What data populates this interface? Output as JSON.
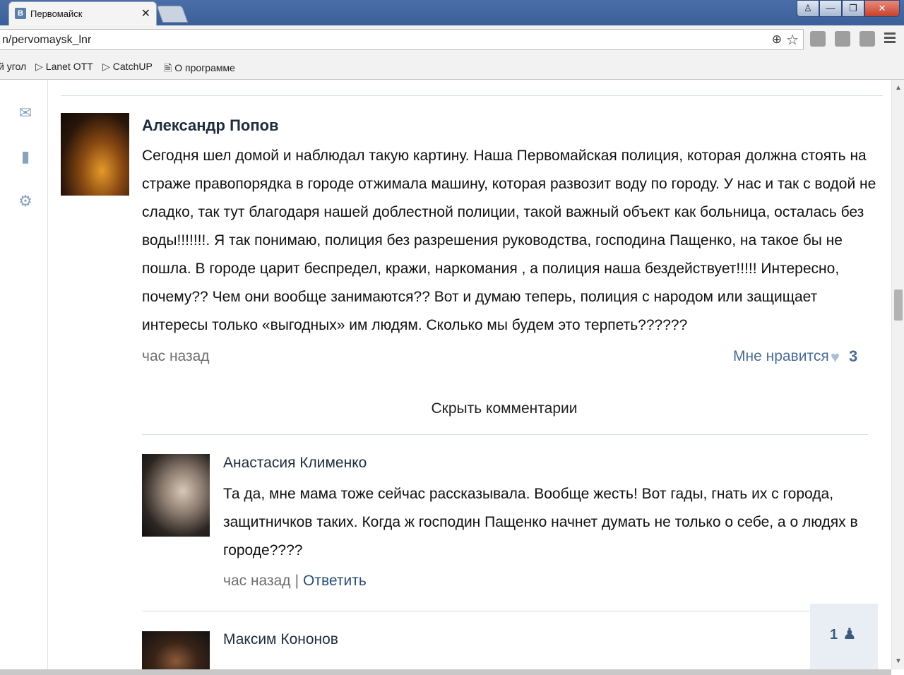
{
  "browser": {
    "tab_title": "Первомайск",
    "favicon_letter": "В",
    "tab_close": "✕",
    "url": "n/pervomaysk_lnr",
    "bookmarks": [
      {
        "label": "й угол"
      },
      {
        "label": "Lanet OTT"
      },
      {
        "label": "CatchUP"
      },
      {
        "label": "О программе"
      }
    ]
  },
  "post": {
    "author": "Александр Попов",
    "text": "Сегодня шел домой и наблюдал такую картину. Наша Первомайская полиция, которая должна стоять на страже правопорядка в городе отжимала машину, которая развозит воду по городу. У нас и так с водой не сладко, так тут благодаря нашей доблестной полиции, такой важный объект как больница, осталась без воды!!!!!!!. Я так понимаю, полиция без разрешения руководства, господина Пащенко, на такое бы не пошла. В городе царит беспредел, кражи, наркомания , а полиция наша бездействует!!!!! Интересно, почему?? Чем они вообще занимаются?? Вот и думаю теперь, полиция с народом или защищает интересы только «выгодных» им людям. Сколько мы будем это терпеть??????",
    "time": "час назад",
    "like_label": "Мне нравится",
    "like_count": "3",
    "hide_comments": "Скрыть комментарии"
  },
  "comments": [
    {
      "author": "Анастасия Клименко",
      "text": "Та да, мне мама тоже сейчас рассказывала. Вообще жесть! Вот гады, гнать их с города, защитничков таких. Когда ж господин Пащенко начнет думать не только о себе, а о людях в городе????",
      "time": "час назад",
      "separator": "|",
      "reply": "Ответить"
    },
    {
      "author": "Максим Кононов"
    }
  ],
  "online_widget": {
    "count": "1"
  }
}
